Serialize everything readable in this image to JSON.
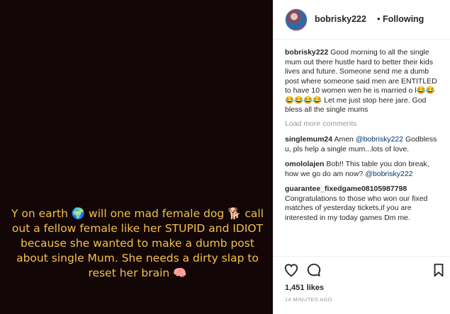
{
  "media": {
    "caption": "Y on earth 🌍 will one mad female dog 🐕 call out a fellow female like her STUPID and IDIOT because she wanted to make a dumb post about single Mum. She needs a dirty slap to reset her brain 🧠"
  },
  "header": {
    "username": "bobrisky222",
    "separator": "•",
    "follow_status": "Following"
  },
  "post": {
    "author": "bobrisky222",
    "text_part1": "Good morning to all the single mum out there hustle hard to better their kids lives and future. Someone send me a dumb post where someone said men are ENTITLED to have 10 women wen he is married o l",
    "emoji": "😂😂😂😂😂😂",
    "text_part2": " Let me just stop here jare. God bless all the single mums"
  },
  "load_more_label": "Load more comments",
  "comments": [
    {
      "user": "singlemum24",
      "text": "Amen ",
      "mention": "@bobrisky222",
      "text2": " Godbless u, pls help a single mum...lots of love."
    },
    {
      "user": "omololajen",
      "text": "Bob!! This table you don break, how we go do am now? ",
      "mention": "@bobrisky222",
      "text2": ""
    },
    {
      "user": "guarantee_fixedgame08105987798",
      "text": "Congratulations to those who won our fixed matches of yesterday tickets,if you are interested in my today games Dm me.",
      "mention": "",
      "text2": ""
    }
  ],
  "actions": {
    "heart_icon": "heart-icon",
    "comment_icon": "comment-icon",
    "bookmark_icon": "bookmark-icon"
  },
  "likes": "1,451 likes",
  "timestamp": "14 MINUTES AGO",
  "colors": {
    "caption": "#f2c24a",
    "media_bg": "#110505",
    "link": "#003569",
    "muted": "#999999"
  }
}
